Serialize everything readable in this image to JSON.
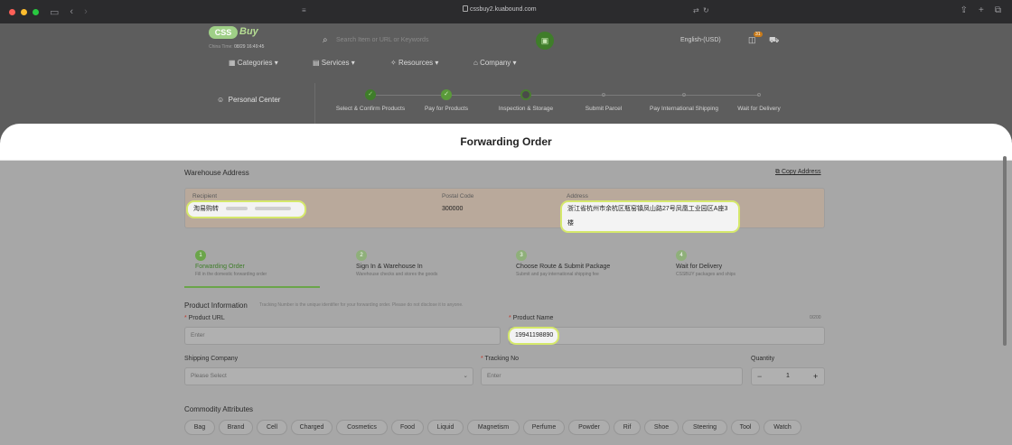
{
  "browser": {
    "url": "cssbuy2.kuabound.com"
  },
  "site": {
    "logo_text": "CSS",
    "logo_buy": "Buy",
    "china_time_label": "China Time:",
    "china_time_value": "08/29 16:49:45",
    "search_placeholder": "Search Item or URL or Keywords",
    "language": "English-(USD)",
    "notification_count": "31",
    "nav": [
      "Categories",
      "Services",
      "Resources",
      "Company"
    ],
    "sidebar_item": "Personal Center",
    "order_steps": [
      {
        "label": "Select & Confirm Products",
        "state": "done"
      },
      {
        "label": "Pay for Products",
        "state": "done"
      },
      {
        "label": "Inspection & Storage",
        "state": "current"
      },
      {
        "label": "Submit Parcel",
        "state": "todo"
      },
      {
        "label": "Pay International Shipping",
        "state": "todo"
      },
      {
        "label": "Wait for Delivery",
        "state": "todo"
      }
    ]
  },
  "modal": {
    "title": "Forwarding Order",
    "warehouse": {
      "section_title": "Warehouse Address",
      "copy_label": "Copy Address",
      "recipient_label": "Recipient",
      "recipient_value": "淘易购转",
      "postal_label": "Postal Code",
      "postal_value": "300000",
      "address_label": "Address",
      "address_value": "浙江省杭州市余杭区瓶窑镇凤山路27号凤凰工业园区A座3楼"
    },
    "flow_steps": [
      {
        "num": "1",
        "title": "Forwarding Order",
        "sub": "Fill in the domestic forwarding order"
      },
      {
        "num": "2",
        "title": "Sign In & Warehouse In",
        "sub": "Warehouse checks and stores the goods"
      },
      {
        "num": "3",
        "title": "Choose Route & Submit Package",
        "sub": "Submit and pay international shipping fee"
      },
      {
        "num": "4",
        "title": "Wait for Delivery",
        "sub": "CSSBUY packages and ships"
      }
    ],
    "product": {
      "section_title": "Product Information",
      "section_hint": "Tracking Number is the unique identifier for your forwarding order. Please do not disclose it to anyone.",
      "url_label": "Product URL",
      "url_placeholder": "Enter",
      "name_label": "Product Name",
      "name_value": "19941198890",
      "name_counter": "0/200",
      "shipping_label": "Shipping Company",
      "shipping_placeholder": "Please Select",
      "tracking_label": "Tracking No",
      "tracking_placeholder": "Enter",
      "quantity_label": "Quantity",
      "quantity_value": "1",
      "minus": "−",
      "plus": "+"
    },
    "attributes": {
      "section_title": "Commodity Attributes",
      "chips": [
        "Bag",
        "Brand",
        "Cell",
        "Charged",
        "Cosmetics",
        "Food",
        "Liquid",
        "Magnetism",
        "Perfume",
        "Powder",
        "Rif",
        "Shoe",
        "Steering",
        "Tool",
        "Watch"
      ]
    }
  },
  "colors": {
    "accent": "#6ba54a",
    "highlight_ring": "#d5e86b",
    "brand_green": "#9fcf87"
  }
}
